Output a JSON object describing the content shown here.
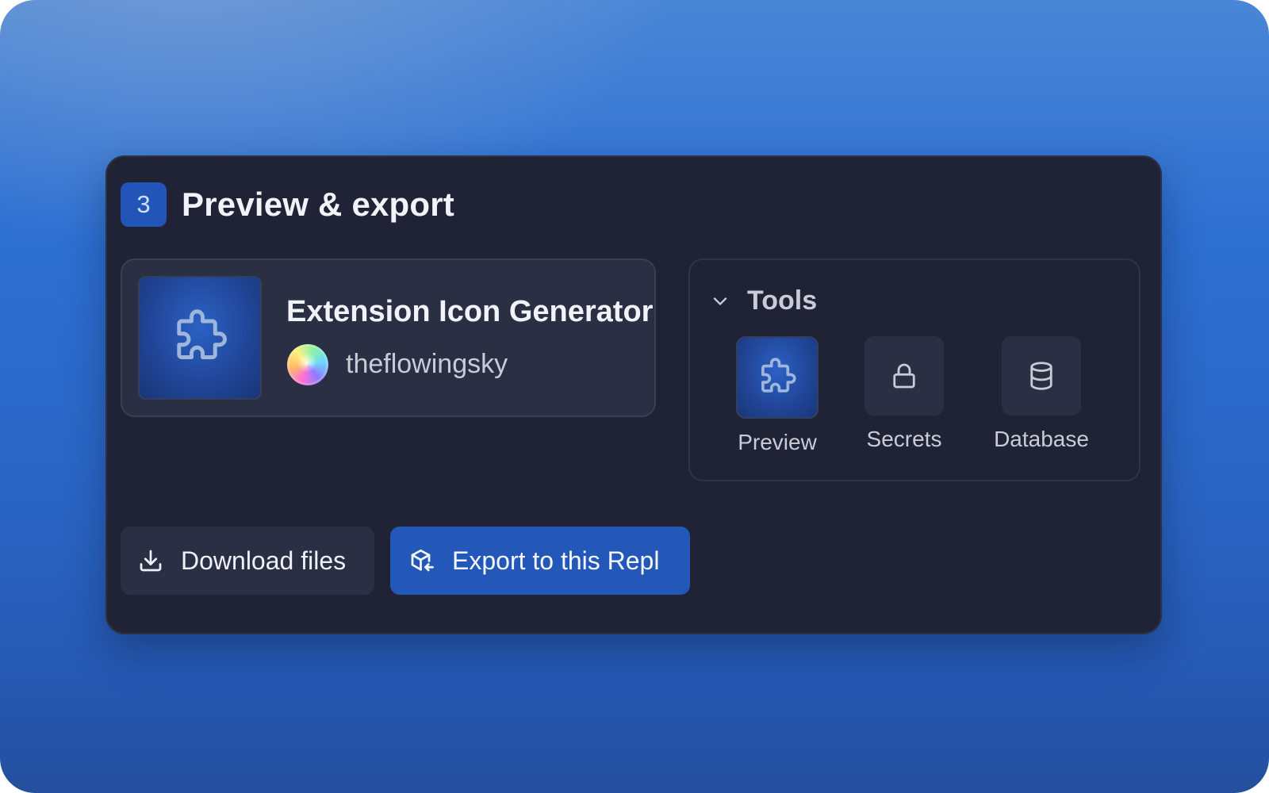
{
  "step": {
    "number": "3",
    "title": "Preview & export"
  },
  "repl": {
    "title": "Extension Icon Generator",
    "author": "theflowingsky",
    "thumbnail_icon": "puzzle-icon",
    "avatar_icon": "rainbow-orb-avatar"
  },
  "tools": {
    "title": "Tools",
    "expanded": true,
    "items": [
      {
        "label": "Preview",
        "icon": "puzzle-icon",
        "active": true
      },
      {
        "label": "Secrets",
        "icon": "lock-icon",
        "active": false
      },
      {
        "label": "Database",
        "icon": "database-icon",
        "active": false
      }
    ]
  },
  "actions": {
    "download_label": "Download files",
    "download_icon": "download-icon",
    "export_label": "Export to this Repl",
    "export_icon": "export-cube-icon"
  },
  "colors": {
    "card_background": "#1f2335",
    "accent": "#2458b8",
    "secondary_button": "#2b2f44",
    "text_primary": "#f1f3f8",
    "text_secondary": "#c9ccd6"
  }
}
